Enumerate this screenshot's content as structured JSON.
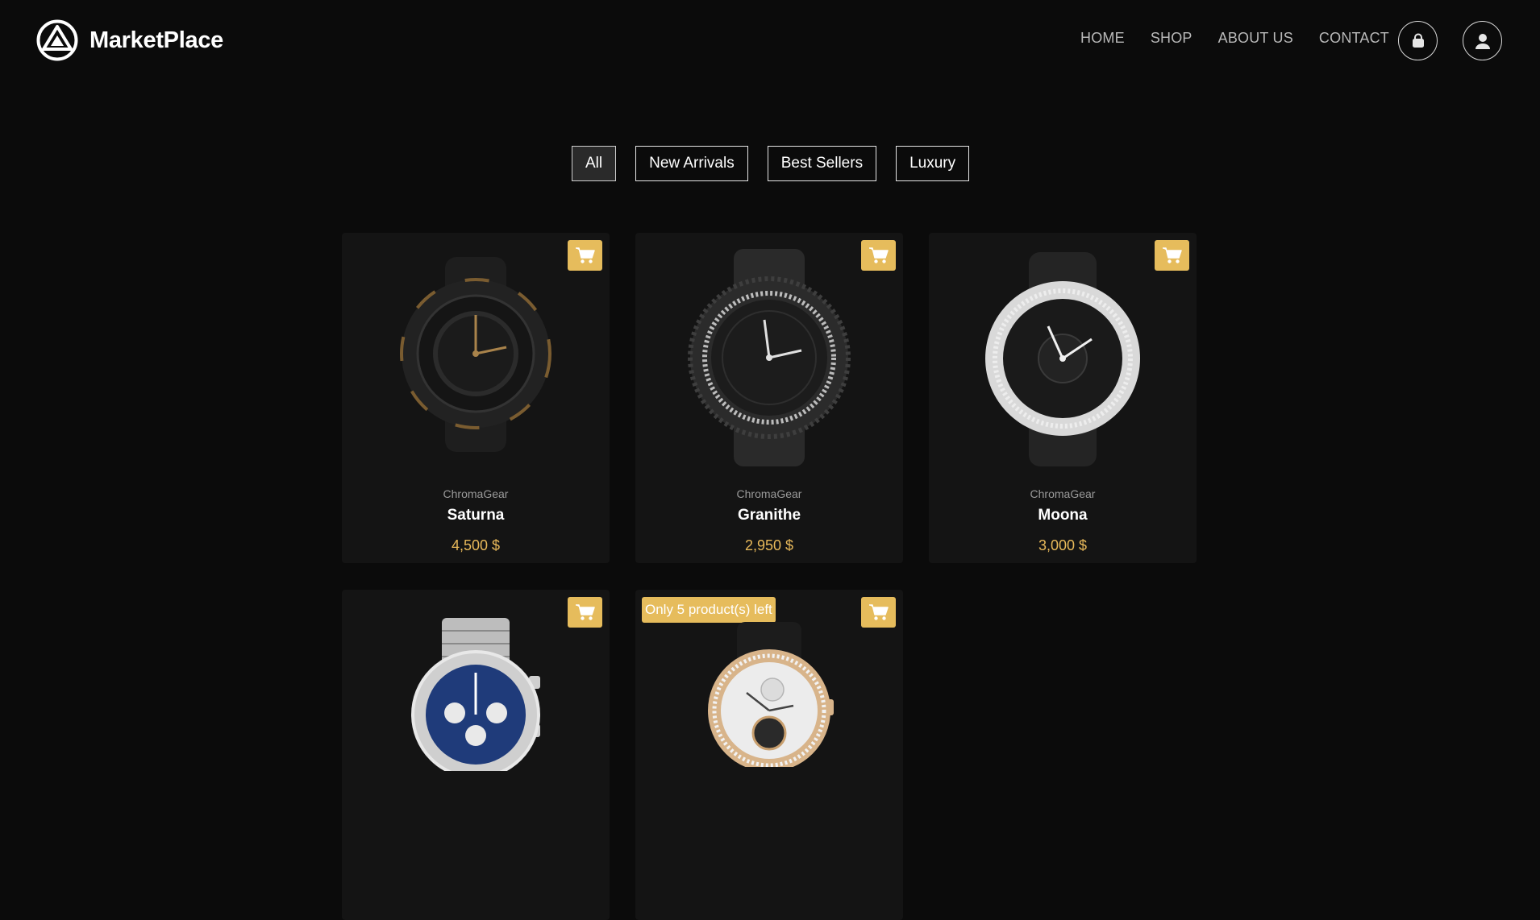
{
  "brand": {
    "name": "MarketPlace"
  },
  "nav": {
    "items": [
      "HOME",
      "SHOP",
      "ABOUT US",
      "CONTACT"
    ],
    "icons": [
      "shopping-bag-icon",
      "user-icon"
    ]
  },
  "filters": [
    {
      "label": "All",
      "active": true
    },
    {
      "label": "New Arrivals",
      "active": false
    },
    {
      "label": "Best Sellers",
      "active": false
    },
    {
      "label": "Luxury",
      "active": false
    }
  ],
  "products": [
    {
      "brand": "ChromaGear",
      "name": "Saturna",
      "price": "4,500 $",
      "badge": ""
    },
    {
      "brand": "ChromaGear",
      "name": "Granithe",
      "price": "2,950 $",
      "badge": ""
    },
    {
      "brand": "ChromaGear",
      "name": "Moona",
      "price": "3,000 $",
      "badge": ""
    },
    {
      "brand": "",
      "name": "",
      "price": "",
      "badge": ""
    },
    {
      "brand": "",
      "name": "",
      "price": "",
      "badge": "Only 5 product(s) left"
    }
  ],
  "colors": {
    "accent": "#e6bc5c",
    "price": "#e8b95a",
    "background": "#0b0b0b",
    "card": "#141414"
  }
}
